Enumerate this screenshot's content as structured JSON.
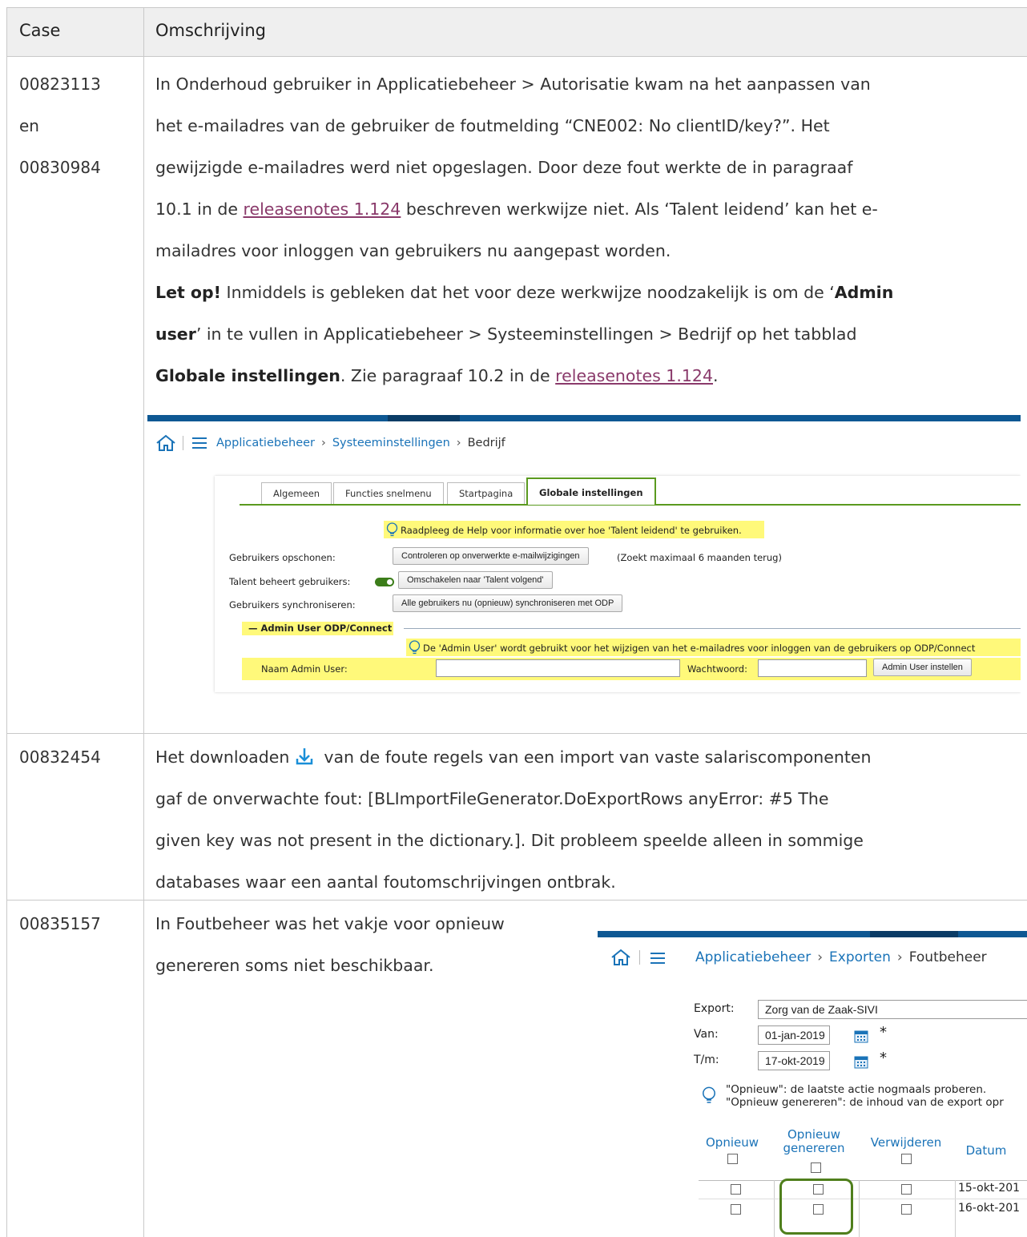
{
  "table": {
    "headers": {
      "case": "Case",
      "description": "Omschrijving"
    }
  },
  "row1": {
    "case_lines": [
      "00823113",
      "en",
      "00830984"
    ],
    "line1": "In Onderhoud gebruiker in Applicatiebeheer > Autorisatie kwam na het aanpassen van",
    "line2": "het e-mailadres van de gebruiker de foutmelding “CNE002: No clientID/key?”. Het",
    "line3": "gewijzigde e-mailadres werd niet opgeslagen. Door deze fout werkte de in paragraaf",
    "line4_a": "10.1 in de ",
    "line4_link": "releasenotes 1.124",
    "line4_b": " beschreven werkwijze niet. Als ‘Talent leidend’ kan het e-",
    "line5": "mailadres voor inloggen van gebruikers nu aangepast worden.",
    "line6_bold": "Let op!",
    "line6_a": " Inmiddels is gebleken dat het voor deze werkwijze noodzakelijk is om de ‘",
    "line6_bold2": "Admin",
    "line7_bold": "user",
    "line7_a": "’ in te vullen in Applicatiebeheer > Systeeminstellingen > Bedrijf op het tabblad",
    "line8_bold": "Globale instellingen",
    "line8_a": ". Zie paragraaf 10.2 in de ",
    "line8_link": "releasenotes 1.124",
    "line8_b": "."
  },
  "screenshot1": {
    "breadcrumb": [
      "Applicatiebeheer",
      "Systeeminstellingen",
      "Bedrijf"
    ],
    "tabs": [
      "Algemeen",
      "Functies snelmenu",
      "Startpagina",
      "Globale instellingen"
    ],
    "help_text": "Raadpleeg de Help voor informatie over hoe 'Talent leidend' te gebruiken.",
    "cleanup_label": "Gebruikers opschonen:",
    "cleanup_button": "Controleren op onverwerkte e-mailwijzigingen",
    "cleanup_note": "(Zoekt maximaal 6 maanden terug)",
    "talent_label": "Talent beheert gebruikers:",
    "talent_button": "Omschakelen naar 'Talent volgend'",
    "sync_label": "Gebruikers synchroniseren:",
    "sync_button": "Alle gebruikers nu (opnieuw) synchroniseren met ODP",
    "section_title": "Admin User ODP/Connect",
    "admin_help": "De 'Admin User' wordt gebruikt voor het wijzigen van het e-mailadres voor inloggen van de gebruikers op ODP/Connect",
    "admin_name_label": "Naam Admin User:",
    "password_label": "Wachtwoord:",
    "admin_button": "Admin User instellen"
  },
  "row2": {
    "case": "00832454",
    "line1_a": "Het downloaden ",
    "line1_b": " van de foute regels van een import van vaste salariscomponenten",
    "line2": "gaf de onverwachte fout: [BLImportFileGenerator.DoExportRows anyError: #5 The",
    "line3": "given key was not present in the dictionary.]. Dit probleem speelde alleen in sommige",
    "line4": "databases waar een aantal foutomschrijvingen ontbrak."
  },
  "row3": {
    "case": "00835157",
    "line1": "In Foutbeheer was het vakje voor opnieuw",
    "line2": "genereren soms niet beschikbaar."
  },
  "screenshot2": {
    "breadcrumb": [
      "Applicatiebeheer",
      "Exporten",
      "Foutbeheer"
    ],
    "export_label": "Export:",
    "export_value": "Zorg van de Zaak-SIVI",
    "from_label": "Van:",
    "from_value": "01-jan-2019",
    "to_label": "T/m:",
    "to_value": "17-okt-2019",
    "required_mark": "*",
    "hint1": "\"Opnieuw\": de laatste actie nogmaals proberen.",
    "hint2": "\"Opnieuw genereren\": de inhoud van de export opr",
    "col_opnieuw": "Opnieuw",
    "col_opnieuw_gen_1": "Opnieuw",
    "col_opnieuw_gen_2": "genereren",
    "col_verwijderen": "Verwijderen",
    "col_datum": "Datum",
    "rows": [
      "15-okt-201",
      "16-okt-201"
    ]
  },
  "colors": {
    "link": "#8a3a6b",
    "accent_blue": "#1a73b8",
    "header_bg": "#efefef",
    "highlight": "#fff97a",
    "green": "#5a9a1f"
  }
}
